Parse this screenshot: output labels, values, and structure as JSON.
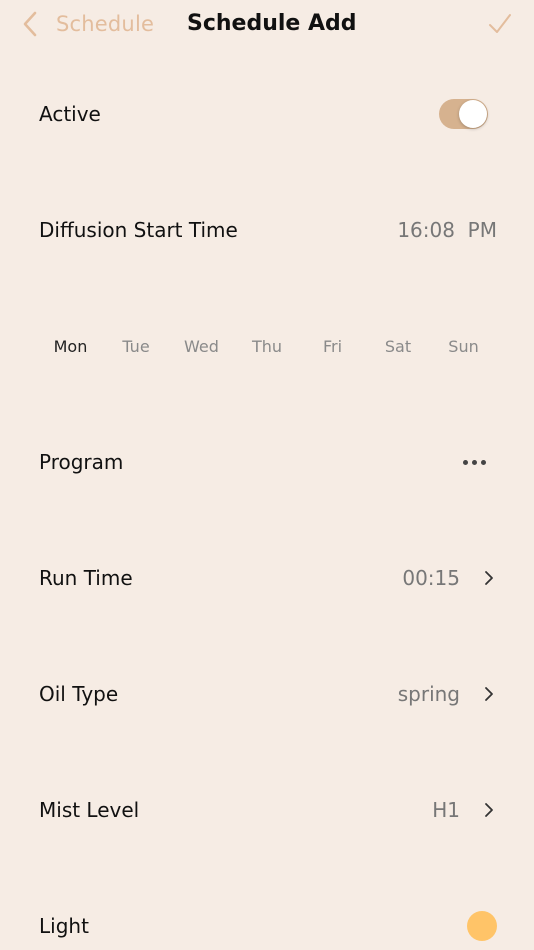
{
  "nav": {
    "back_label": "Schedule",
    "title": "Schedule Add"
  },
  "rows": {
    "active": {
      "label": "Active",
      "enabled": true
    },
    "start_time": {
      "label": "Diffusion Start Time",
      "value": "16:08  PM"
    },
    "program": {
      "label": "Program"
    },
    "run_time": {
      "label": "Run Time",
      "value": "00:15"
    },
    "oil_type": {
      "label": "Oil Type",
      "value": "spring"
    },
    "mist_level": {
      "label": "Mist Level",
      "value": "H1"
    },
    "light": {
      "label": "Light"
    }
  },
  "days": [
    {
      "label": "Mon",
      "selected": true
    },
    {
      "label": "Tue",
      "selected": false
    },
    {
      "label": "Wed",
      "selected": false
    },
    {
      "label": "Thu",
      "selected": false
    },
    {
      "label": "Fri",
      "selected": false
    },
    {
      "label": "Sat",
      "selected": false
    },
    {
      "label": "Sun",
      "selected": false
    }
  ],
  "colors": {
    "background": "#f6ece4",
    "accent": "#e3bd9d",
    "toggle_on": "#d6b28f",
    "light_swatch": "#ffc468"
  },
  "icons": {
    "back": "chevron-left-icon",
    "confirm": "checkmark-icon",
    "more": "more-dots-icon",
    "disclosure": "chevron-right-icon"
  }
}
